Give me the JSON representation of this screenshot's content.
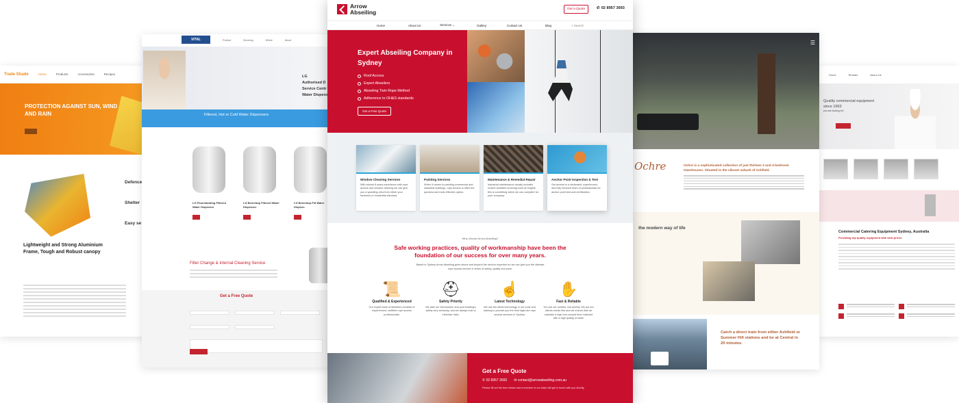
{
  "colors": {
    "arrow_red": "#c8102e",
    "arrow_blue": "#28a6d8",
    "tradeshade_orange": "#f08a1c",
    "vital_blue": "#3a9be0",
    "ochre_brown": "#b05a2f",
    "catering_red": "#c3242f"
  },
  "p1": {
    "logo": "Trade Shade",
    "nav": [
      "Home",
      "Products",
      "Accessories",
      "Recipes"
    ],
    "hero_title": "PROTECTION AGAINST SUN, WIND AND RAIN",
    "side": [
      "Defence",
      "Shelter",
      "Easy se"
    ],
    "heading": "Lightweight and Strong Aluminium Frame, Tough and Robust canopy"
  },
  "p2": {
    "logo": "VITAL",
    "nav": [
      "Home",
      "Product",
      "Servicing",
      "Where",
      "About"
    ],
    "hero_brand": "LG",
    "hero_line1": "Authorised D",
    "hero_line2": "Service Centr",
    "hero_line3": "Water Dispens",
    "band_title": "Filtered, Hot or Cold Water Dispensers",
    "products": [
      {
        "name": "LG Floorstanding Filtered Water Dispenser"
      },
      {
        "name": "LG Benchtop Filtered Water Dispenser"
      },
      {
        "name": "LG Benchtop Filt Water Dispens"
      }
    ],
    "filter_title": "Filter Change & Internal Cleaning Service",
    "quote_title": "Get a Free Quote"
  },
  "p3": {
    "brand_line1": "Arrow",
    "brand_line2": "Abseiling",
    "quote_button": "Get a Quote",
    "phone": "02 8957 3693",
    "nav": {
      "home": "Home",
      "about": "About Us",
      "services": "Services",
      "gallery": "Gallery",
      "contact": "Contact Us",
      "blog": "Blog",
      "search": "Search"
    },
    "hero": {
      "title": "Expert Abseiling Company in Sydney",
      "points": [
        "Roof Access",
        "Expert Abseilers",
        "Abseiling Twin Rope Method",
        "Adherence to OH&S standards"
      ],
      "cta": "Get a Free Quote"
    },
    "services": [
      {
        "title": "Window Cleaning Services",
        "desc": "With almost 8 years experience with rope access and window cleaning we can give you a sparkling view from either your business or residential windows."
      },
      {
        "title": "Painting Services",
        "desc": "When it comes to painting commercial and industrial buildings, rope access is often the quickest and most effective option."
      },
      {
        "title": "Maintenance & Remedial Repair",
        "desc": "Industrial maintenance usually includes routine activities involving work at heights this is something which we can complete for your company."
      },
      {
        "title": "Anchor Point Inspection & Test",
        "desc": "Get access to a dedicated, experienced, and fully licensed team of professionals for anchor point test and certification."
      }
    ],
    "why": {
      "kicker": "Why choose Arrow Abseiling?",
      "title": "Safe working practices, quality of workmanship have been the foundation of our success for over many years.",
      "intro": "Based in Sydney Arrow Abseiling goes above and beyond the service expected so we can give you the ultimate rope access service in terms of safety, quality and price."
    },
    "features": [
      {
        "icon": "certificate-icon",
        "title": "Qualified & Experienced",
        "desc": "Our expert team of abseilers consists of experienced, certified rope access professionals."
      },
      {
        "icon": "hard-hat-icon",
        "title": "Safety Priority",
        "desc": "We take our technicians' and your building's safety very seriously, and we always look to minimise risks."
      },
      {
        "icon": "touch-tech-icon",
        "title": "Latest Technology",
        "desc": "We use the latest technology in our tools and training to provide you the best high-rise rope access services in Sydney."
      },
      {
        "icon": "hand-ok-icon",
        "title": "Fast & Reliable",
        "desc": "You are our number one priority. We put our clients needs first and we ensure that we maintain a high turn-around time matched with a high quality of work!"
      }
    ],
    "footer": {
      "title": "Get a Free Quote",
      "phone": "02 8957 3693",
      "email": "contact@arrowabseiling.com.au",
      "note": "Please fill out the form below and a member of our team will get in touch with you shortly."
    }
  },
  "p4": {
    "script_logo": "Ochre",
    "intro_title": "Ochre is a sophisticated collection of just thirteen 3 and 4-bedroom townhouses. Situated in the vibrant suburb of Ashfield.",
    "modern_title": "the modern way of life",
    "train_title": "Catch a direct train from either Ashfield or Summer Hill stations and be at Central in 20 minutes.",
    "train_sub": "Jump on the Hume Highway and connect to arterial roads that can take you north, south, east or west."
  },
  "p5": {
    "nav": [
      "Home",
      "Rentals",
      "About Us"
    ],
    "hero_text": "Quality commercial equipment since 1963",
    "hero_sub": "you are looking for!",
    "title": "Commercial Catering Equipment Sydney, Australia",
    "subtitle": "Providing top quality equipment with best prices"
  }
}
